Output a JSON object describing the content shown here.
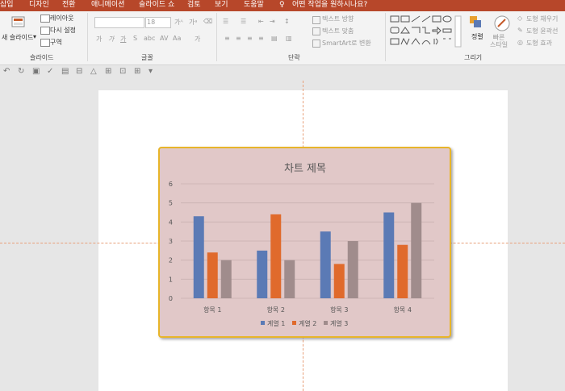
{
  "tabs": [
    "삽입",
    "디자인",
    "전환",
    "애니메이션",
    "슬라이드 쇼",
    "검토",
    "보기",
    "도움말"
  ],
  "tell_me": "어떤 작업을 원하시나요?",
  "ribbon": {
    "slides": {
      "new_slide": "새 슬라이드",
      "layout": "레이아웃",
      "reset": "다시 설정",
      "section": "구역",
      "group_label": "슬라이드"
    },
    "font": {
      "font_size": "18",
      "group_label": "글꼴"
    },
    "paragraph": {
      "text_direction": "텍스트 방향",
      "align_text": "텍스트 맞춤",
      "smartart": "SmartArt로 변환",
      "group_label": "단락"
    },
    "drawing": {
      "arrange": "정렬",
      "quick_styles": "빠른\n스타일",
      "fill": "도형 채우기",
      "outline": "도형 윤곽선",
      "effects": "도형 효과",
      "group_label": "그리기"
    }
  },
  "chart_data": {
    "type": "bar",
    "title": "차트 제목",
    "categories": [
      "항목 1",
      "항목 2",
      "항목 3",
      "항목 4"
    ],
    "series": [
      {
        "name": "계열 1",
        "color": "#5b7ab5",
        "values": [
          4.3,
          2.5,
          3.5,
          4.5
        ]
      },
      {
        "name": "계열 2",
        "color": "#e06a2c",
        "values": [
          2.4,
          4.4,
          1.8,
          2.8
        ]
      },
      {
        "name": "계열 3",
        "color": "#a08c8c",
        "values": [
          2.0,
          2.0,
          3.0,
          5.0
        ]
      }
    ],
    "ylim": [
      0,
      6
    ],
    "yticks": [
      "0",
      "1",
      "2",
      "3",
      "4",
      "5",
      "6"
    ],
    "grid": true,
    "legend": "bottom"
  }
}
